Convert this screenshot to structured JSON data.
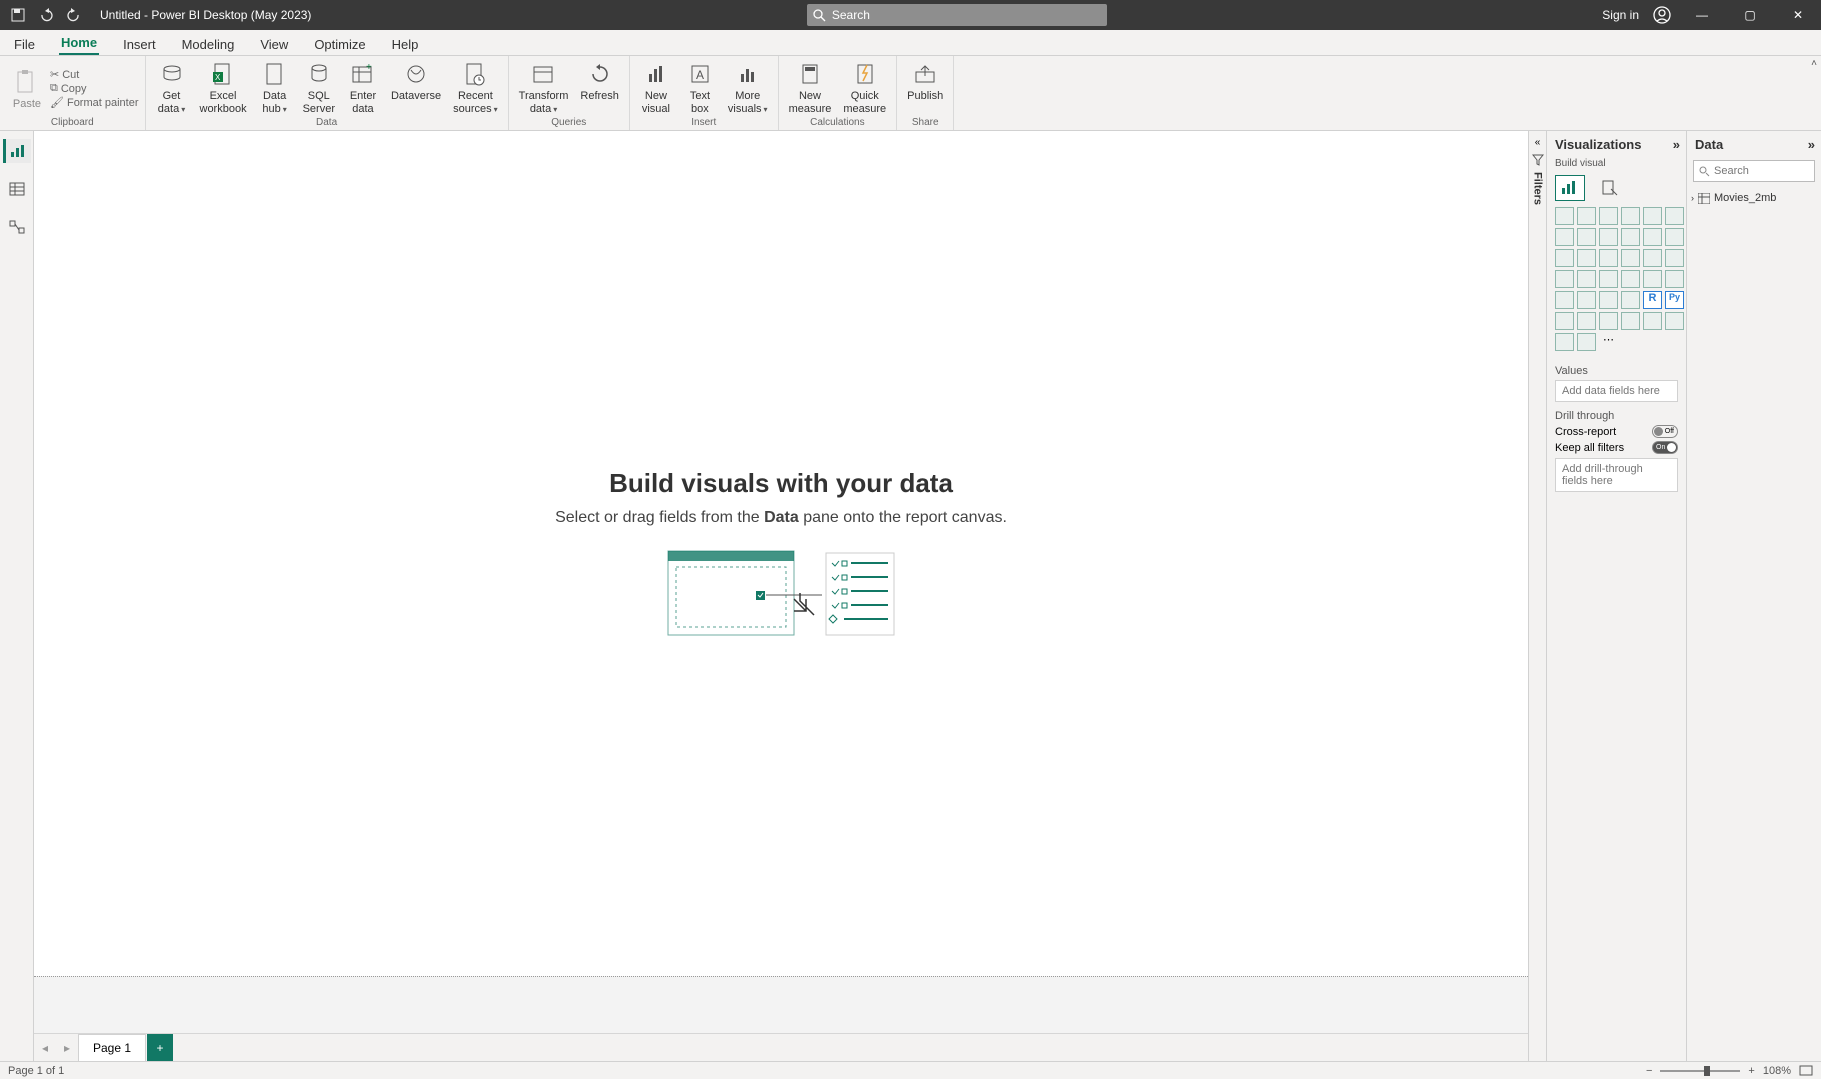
{
  "titlebar": {
    "title": "Untitled - Power BI Desktop (May 2023)",
    "search_placeholder": "Search",
    "signin": "Sign in"
  },
  "tabs": [
    "File",
    "Home",
    "Insert",
    "Modeling",
    "View",
    "Optimize",
    "Help"
  ],
  "active_tab": "Home",
  "ribbon": {
    "clipboard": {
      "label": "Clipboard",
      "paste": "Paste",
      "cut": "Cut",
      "copy": "Copy",
      "format_painter": "Format painter"
    },
    "data": {
      "label": "Data",
      "get_data": "Get\ndata",
      "excel": "Excel\nworkbook",
      "datahub": "Data\nhub",
      "sql": "SQL\nServer",
      "enter": "Enter\ndata",
      "dataverse": "Dataverse",
      "recent": "Recent\nsources"
    },
    "queries": {
      "label": "Queries",
      "transform": "Transform\ndata",
      "refresh": "Refresh"
    },
    "insert": {
      "label": "Insert",
      "new_visual": "New\nvisual",
      "text_box": "Text\nbox",
      "more": "More\nvisuals"
    },
    "calculations": {
      "label": "Calculations",
      "new_measure": "New\nmeasure",
      "quick_measure": "Quick\nmeasure"
    },
    "share": {
      "label": "Share",
      "publish": "Publish"
    }
  },
  "canvas": {
    "heading": "Build visuals with your data",
    "subtext_pre": "Select or drag fields from the ",
    "subtext_bold": "Data",
    "subtext_post": " pane onto the report canvas."
  },
  "page_tab": "Page 1",
  "filters_label": "Filters",
  "viz": {
    "title": "Visualizations",
    "build": "Build visual",
    "values": "Values",
    "values_placeholder": "Add data fields here",
    "drill": "Drill through",
    "cross": "Cross-report",
    "cross_state": "Off",
    "keep": "Keep all filters",
    "keep_state": "On",
    "drill_placeholder": "Add drill-through fields here"
  },
  "data_pane": {
    "title": "Data",
    "search_placeholder": "Search",
    "table": "Movies_2mb"
  },
  "status": {
    "page": "Page 1 of 1",
    "zoom": "108%"
  }
}
